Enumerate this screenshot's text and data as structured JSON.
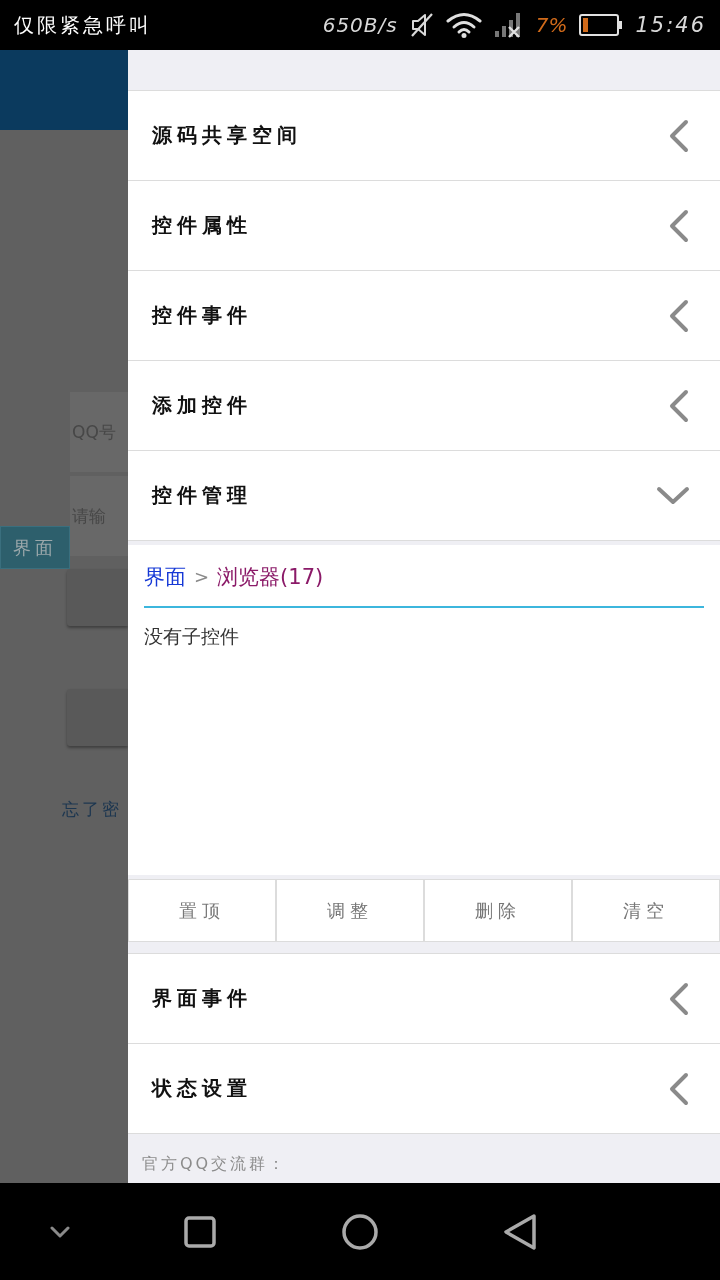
{
  "status_bar": {
    "notice": "仅限紧急呼叫",
    "net_speed": "650B/s",
    "battery_percent": "7%",
    "time": "15:46"
  },
  "background_page": {
    "account_field": {
      "placeholder": "QQ号"
    },
    "password_field": {
      "placeholder": "请输"
    },
    "tab": "界面",
    "link": "忘了密"
  },
  "drawer": {
    "sections_top": [
      {
        "label": "源码共享空间",
        "expanded": false
      },
      {
        "label": "控件属性",
        "expanded": false
      },
      {
        "label": "控件事件",
        "expanded": false
      },
      {
        "label": "添加控件",
        "expanded": false
      },
      {
        "label": "控件管理",
        "expanded": true
      }
    ],
    "breadcrumb": {
      "root": "界面",
      "separator": ">",
      "current": "浏览器(17)"
    },
    "empty_message": "没有子控件",
    "actions": [
      "置顶",
      "调整",
      "删除",
      "清空"
    ],
    "sections_bottom": [
      {
        "label": "界面事件",
        "expanded": false
      },
      {
        "label": "状态设置",
        "expanded": false
      }
    ],
    "footer": "官方QQ交流群："
  }
}
